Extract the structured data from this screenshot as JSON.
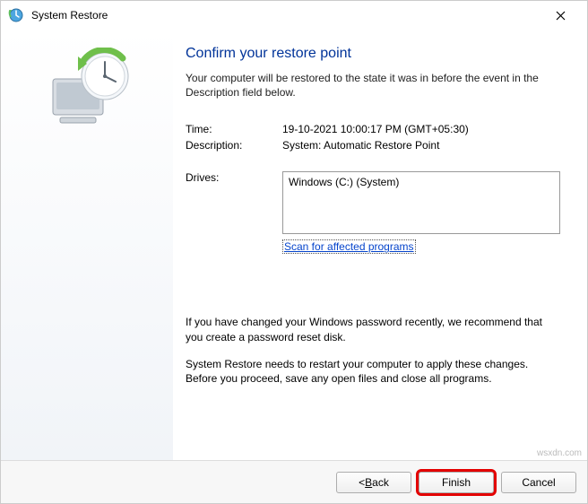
{
  "window": {
    "title": "System Restore"
  },
  "heading": "Confirm your restore point",
  "intro": "Your computer will be restored to the state it was in before the event in the Description field below.",
  "fields": {
    "time_label": "Time:",
    "time_value": "19-10-2021 10:00:17 PM (GMT+05:30)",
    "desc_label": "Description:",
    "desc_value": "System: Automatic Restore Point",
    "drives_label": "Drives:",
    "drives_value": "Windows (C:) (System)"
  },
  "scan_link": "Scan for affected programs",
  "note1": "If you have changed your Windows password recently, we recommend that you create a password reset disk.",
  "note2": "System Restore needs to restart your computer to apply these changes. Before you proceed, save any open files and close all programs.",
  "buttons": {
    "back_prefix": "< ",
    "back_ak": "B",
    "back_suffix": "ack",
    "finish": "Finish",
    "cancel": "Cancel"
  },
  "watermark": "wsxdn.com"
}
